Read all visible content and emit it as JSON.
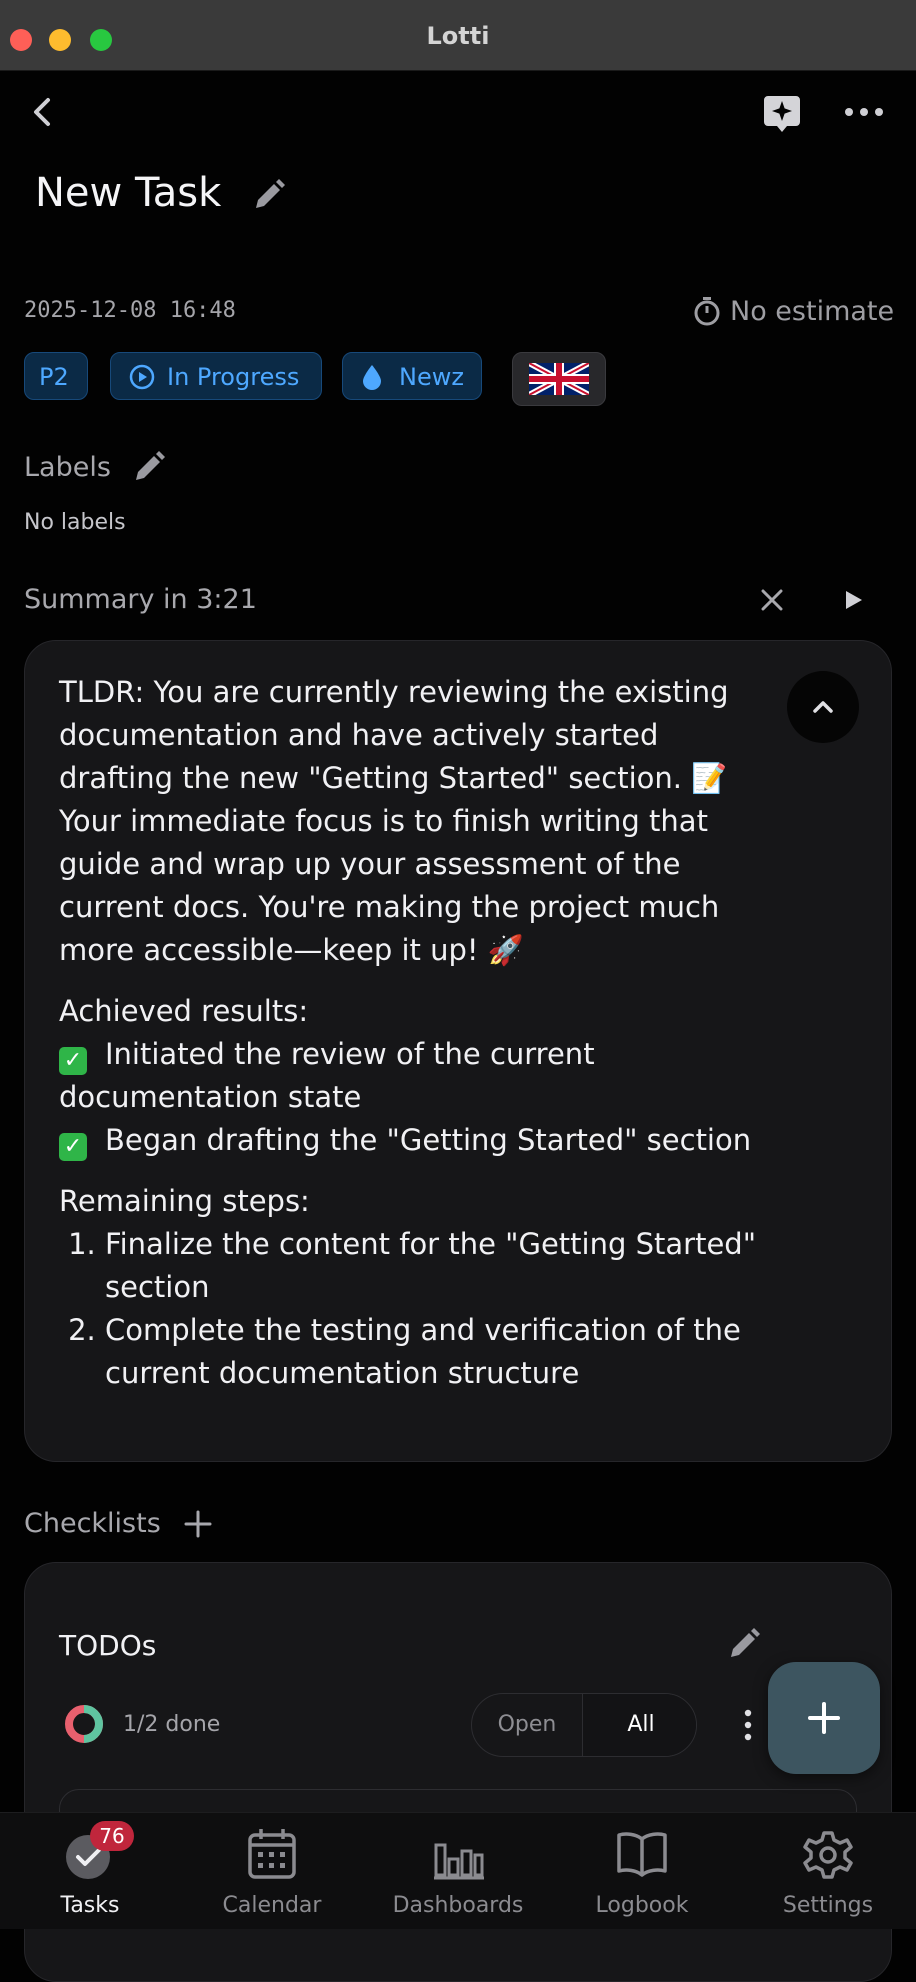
{
  "window": {
    "title": "Lotti"
  },
  "task": {
    "title": "New Task",
    "created": "2025-12-08 16:48",
    "estimate": "No estimate",
    "priority": "P2",
    "status": "In Progress",
    "category": "Newz",
    "language_flag": "uk-flag"
  },
  "labels": {
    "heading": "Labels",
    "empty": "No labels"
  },
  "summary": {
    "heading": "Summary in 3:21",
    "tldr": "TLDR: You are currently reviewing the existing documentation and have actively started drafting the new \"Getting Started\" section. 📝 Your immediate focus is to finish writing that guide and wrap up your assessment of the current docs. You're making the project much more accessible—keep it up! 🚀",
    "achieved_heading": "Achieved results:",
    "achieved": [
      "Initiated the review of the current documentation state",
      "Began drafting the \"Getting Started\" section"
    ],
    "remaining_heading": "Remaining steps:",
    "remaining": [
      "Finalize the content for the \"Getting Started\" section",
      "Complete the testing and verification of the current documentation structure"
    ]
  },
  "checklists": {
    "heading": "Checklists",
    "items": [
      {
        "title": "TODOs",
        "progress_text": "1/2 done",
        "progress": 0.5,
        "filter_open": "Open",
        "filter_all": "All",
        "active_filter": "All"
      }
    ]
  },
  "nav": {
    "items": [
      {
        "label": "Tasks",
        "badge": "76",
        "active": true
      },
      {
        "label": "Calendar"
      },
      {
        "label": "Dashboards"
      },
      {
        "label": "Logbook"
      },
      {
        "label": "Settings"
      }
    ]
  },
  "colors": {
    "accent": "#4ea8ff",
    "chip_bg": "#0b2a46",
    "badge": "#c0263c",
    "fab": "#3d5560",
    "check": "#2fb548"
  }
}
